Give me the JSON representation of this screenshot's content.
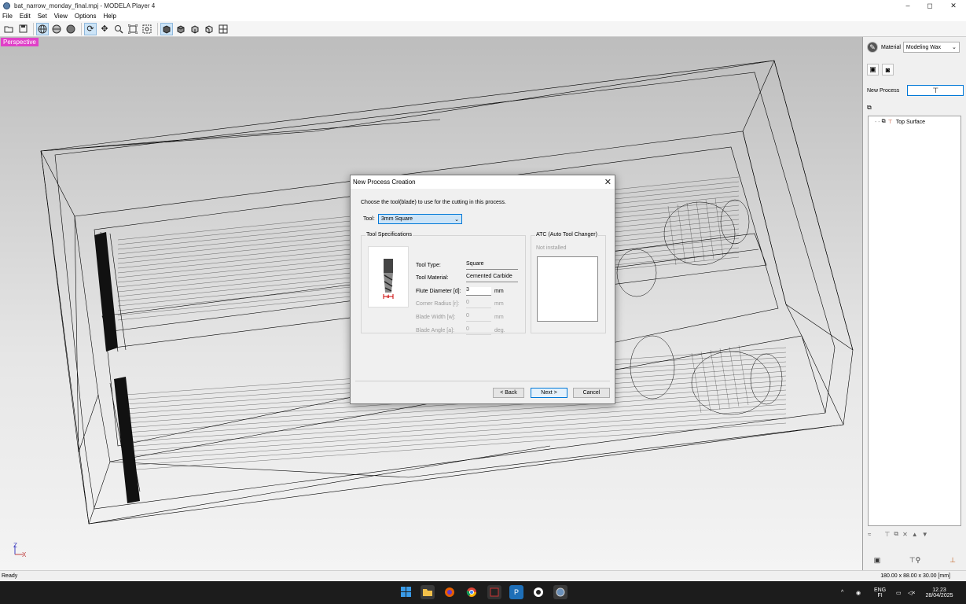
{
  "window": {
    "title": "bat_narrow_monday_final.mpj - MODELA Player 4",
    "minimize": "–",
    "maximize": "◻",
    "close": "✕"
  },
  "menu": [
    "File",
    "Edit",
    "Set",
    "View",
    "Options",
    "Help"
  ],
  "viewport": {
    "view_label": "Perspective",
    "axis_z": "Z",
    "axis_x": "X"
  },
  "right_panel": {
    "material_label": "Material",
    "material_value": "Modeling Wax",
    "new_process_label": "New Process",
    "tree_items": [
      {
        "label": "Top Surface"
      }
    ]
  },
  "status": {
    "left": "Ready",
    "right": "180.00 x 88.00 x 30.00 [mm]"
  },
  "taskbar": {
    "lang": "ENG",
    "lang_sub": "FI",
    "time": "12.23",
    "date": "28/04/2025"
  },
  "dialog": {
    "title": "New Process Creation",
    "instruction": "Choose the tool(blade) to use for the cutting in this process.",
    "tool_label": "Tool:",
    "tool_value": "3mm Square",
    "specs_title": "Tool Specifications",
    "atc_title": "ATC (Auto Tool Changer)",
    "atc_status": "Not installed",
    "fields": [
      {
        "label": "Tool Type:",
        "value": "Square",
        "unit": "",
        "enabled": true
      },
      {
        "label": "Tool Material:",
        "value": "Cemented Carbide",
        "unit": "",
        "enabled": true
      },
      {
        "label": "Flute Diameter [d]:",
        "value": "3",
        "unit": "mm",
        "enabled": true
      },
      {
        "label": "Corner Radius [r]:",
        "value": "0",
        "unit": "mm",
        "enabled": false
      },
      {
        "label": "Blade Width [w]:",
        "value": "0",
        "unit": "mm",
        "enabled": false
      },
      {
        "label": "Blade Angle [a]:",
        "value": "0",
        "unit": "deg.",
        "enabled": false
      }
    ],
    "tool_diagram_label": "d",
    "back_label": "< Back",
    "next_label": "Next >",
    "cancel_label": "Cancel"
  },
  "colors": {
    "view_label_bg": "#e040c8",
    "accent": "#0078d7"
  }
}
